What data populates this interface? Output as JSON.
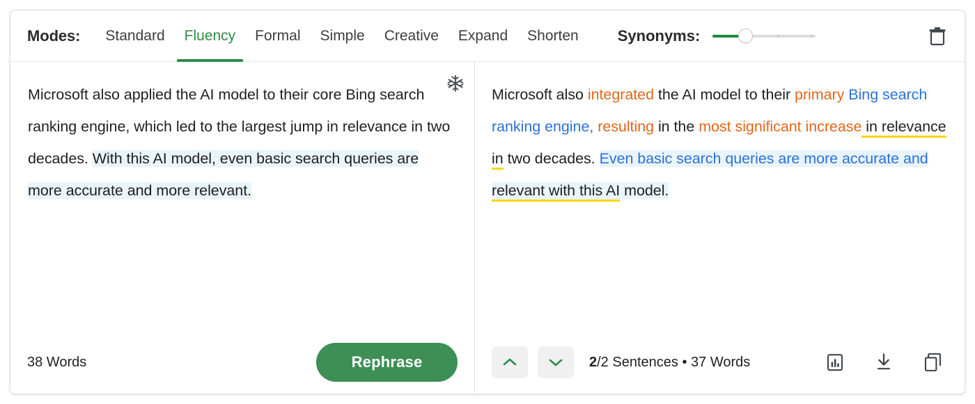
{
  "header": {
    "modes_label": "Modes:",
    "modes": [
      {
        "label": "Standard",
        "active": false
      },
      {
        "label": "Fluency",
        "active": true
      },
      {
        "label": "Formal",
        "active": false
      },
      {
        "label": "Simple",
        "active": false
      },
      {
        "label": "Creative",
        "active": false
      },
      {
        "label": "Expand",
        "active": false
      },
      {
        "label": "Shorten",
        "active": false
      }
    ],
    "synonyms_label": "Synonyms:",
    "synonyms_value": 1,
    "synonyms_max": 4,
    "trash_icon": "trash-icon"
  },
  "left_pane": {
    "snowflake_icon": "snowflake-icon",
    "text_segments": [
      {
        "text": "Microsoft also applied the AI model to their core Bing search ranking engine, which led to the largest jump in relevance in two decades. ",
        "style": "plain"
      },
      {
        "text": "With this AI model, even basic search queries are more accurate and more relevant.",
        "style": "highlight-blue"
      }
    ],
    "full_text": "Microsoft also applied the AI model to their core Bing search ranking engine, which led to the largest jump in relevance in two decades. With this AI model, even basic search queries are more accurate and more relevant.",
    "word_count": "38 Words",
    "rephrase_label": "Rephrase"
  },
  "right_pane": {
    "text_segments": [
      {
        "text": "Microsoft also ",
        "style": "plain"
      },
      {
        "text": "integrated",
        "style": "orange"
      },
      {
        "text": " the AI model to their ",
        "style": "plain"
      },
      {
        "text": "primary Bing search ranking engine,",
        "style": "orange-then-blue"
      },
      {
        "text": " resulting in the most significant increase",
        "style": "mixed"
      },
      {
        "text": " in relevance in",
        "style": "underline-yellow"
      },
      {
        "text": " two decades. ",
        "style": "plain"
      },
      {
        "text": "Even basic search queries are more accurate and",
        "style": "blue-highlight"
      },
      {
        "text": " relevant with this AI",
        "style": "underline-yellow-highlight"
      },
      {
        "text": " model.",
        "style": "highlight"
      }
    ],
    "full_text": "Microsoft also integrated the AI model to their primary Bing search ranking engine, resulting in the most significant increase in relevance in two decades. Even basic search queries are more accurate and relevant with this AI model.",
    "prev_sentence_icon": "chevron-up-icon",
    "next_sentence_icon": "chevron-down-icon",
    "sentence_position": "2",
    "sentence_total": "/2 Sentences",
    "separator": "•",
    "word_count": "37 Words",
    "icons": [
      {
        "name": "stats-icon"
      },
      {
        "name": "download-icon"
      },
      {
        "name": "copy-icon"
      }
    ]
  },
  "colors": {
    "accent_green": "#2e8b4a",
    "button_green": "#3d8f55",
    "synonym_orange": "#e2661a",
    "synonym_blue": "#2a72d4",
    "highlight_blue": "#e9f4fb",
    "underline_yellow": "#fcd40a",
    "text_dark": "#1f1f1f"
  }
}
